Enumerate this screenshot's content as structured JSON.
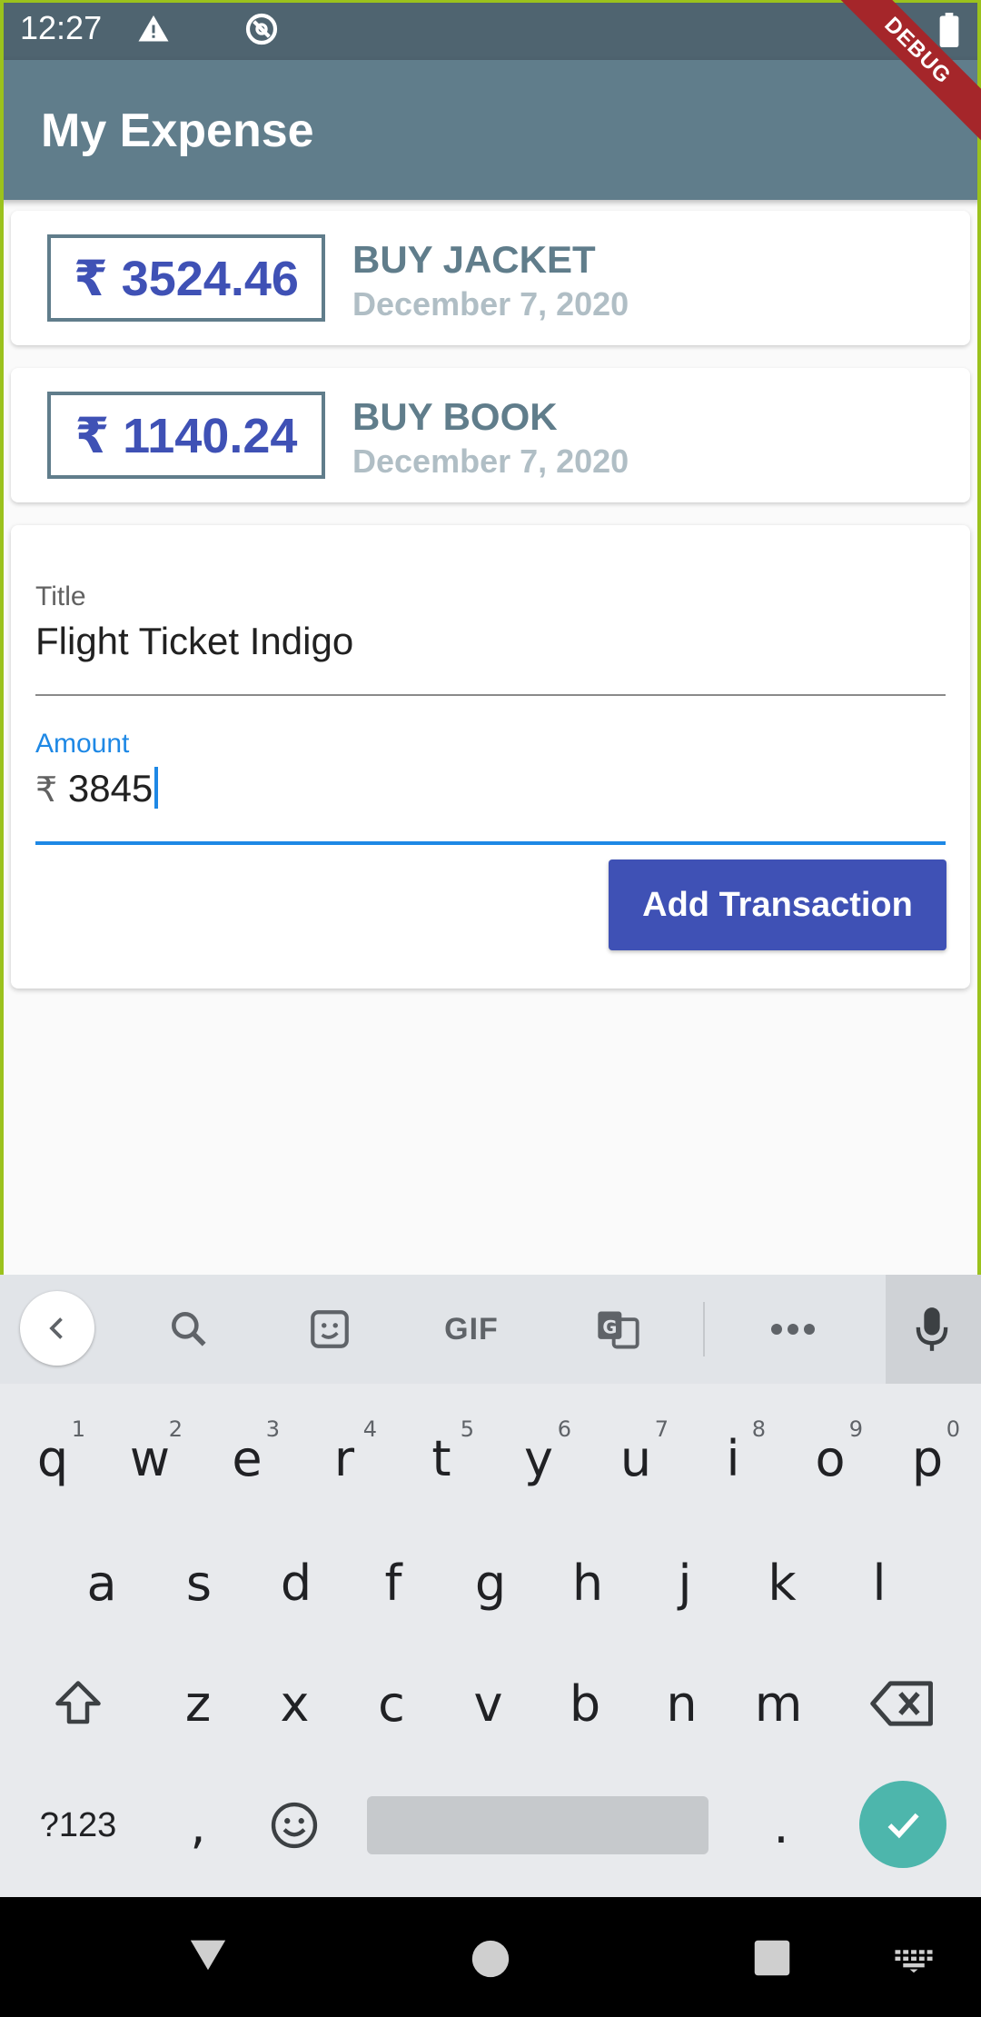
{
  "status_bar": {
    "time": "12:27",
    "icons": [
      "warning-icon",
      "rotate-icon",
      "battery-icon"
    ]
  },
  "app_bar": {
    "title": "My Expense",
    "debug_banner": "DEBUG"
  },
  "transactions": [
    {
      "amount": "₹ 3524.46",
      "title": "BUY JACKET",
      "date": "December 7, 2020"
    },
    {
      "amount": "₹ 1140.24",
      "title": "BUY BOOK",
      "date": "December 7, 2020"
    }
  ],
  "form": {
    "title_label": "Title",
    "title_value": "Flight Ticket Indigo",
    "amount_label": "Amount",
    "amount_prefix": "₹",
    "amount_value": "3845",
    "submit_label": "Add Transaction"
  },
  "keyboard": {
    "toolbar": [
      "back-icon",
      "search-icon",
      "sticker-icon",
      "gif-icon",
      "translate-icon",
      "more-icon",
      "mic-icon"
    ],
    "gif_label": "GIF",
    "row1": [
      {
        "key": "q",
        "hint": "1"
      },
      {
        "key": "w",
        "hint": "2"
      },
      {
        "key": "e",
        "hint": "3"
      },
      {
        "key": "r",
        "hint": "4"
      },
      {
        "key": "t",
        "hint": "5"
      },
      {
        "key": "y",
        "hint": "6"
      },
      {
        "key": "u",
        "hint": "7"
      },
      {
        "key": "i",
        "hint": "8"
      },
      {
        "key": "o",
        "hint": "9"
      },
      {
        "key": "p",
        "hint": "0"
      }
    ],
    "row2": [
      "a",
      "s",
      "d",
      "f",
      "g",
      "h",
      "j",
      "k",
      "l"
    ],
    "row3": [
      "z",
      "x",
      "c",
      "v",
      "b",
      "n",
      "m"
    ],
    "symbols_key": "?123",
    "comma_key": ",",
    "period_key": "."
  },
  "colors": {
    "primary": "#607d8b",
    "accent": "#3f51b5",
    "focus": "#1e88e5",
    "enter": "#4db6ac"
  }
}
